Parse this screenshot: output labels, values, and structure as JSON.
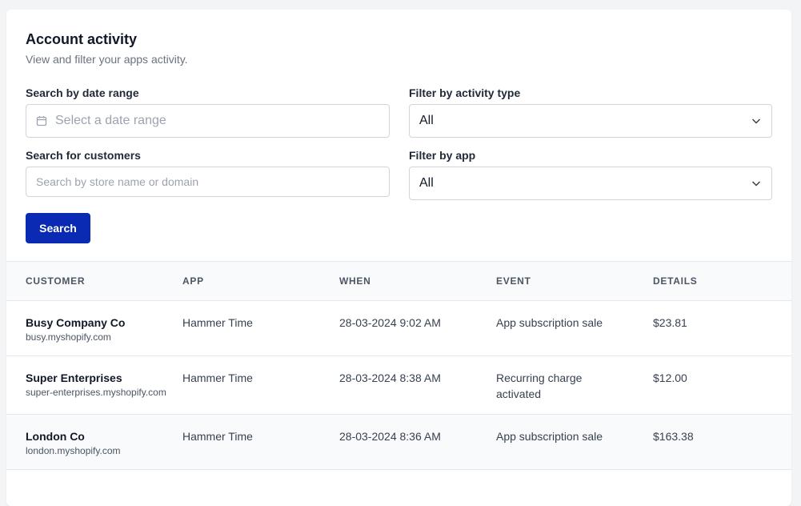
{
  "header": {
    "title": "Account activity",
    "subtitle": "View and filter your apps activity."
  },
  "filters": {
    "date_range": {
      "label": "Search by date range",
      "placeholder": "Select a date range"
    },
    "activity_type": {
      "label": "Filter by activity type",
      "value": "All"
    },
    "customers": {
      "label": "Search for customers",
      "placeholder": "Search by store name or domain"
    },
    "app": {
      "label": "Filter by app",
      "value": "All"
    },
    "search_button": "Search"
  },
  "table": {
    "columns": [
      "CUSTOMER",
      "APP",
      "WHEN",
      "EVENT",
      "DETAILS"
    ],
    "rows": [
      {
        "customer": "Busy Company Co",
        "domain": "busy.myshopify.com",
        "app": "Hammer Time",
        "when": "28-03-2024 9:02 AM",
        "event": "App subscription sale",
        "details": "$23.81"
      },
      {
        "customer": "Super Enterprises",
        "domain": "super-enterprises.myshopify.com",
        "app": "Hammer Time",
        "when": "28-03-2024 8:38 AM",
        "event": "Recurring charge activated",
        "details": "$12.00"
      },
      {
        "customer": "London Co",
        "domain": "london.myshopify.com",
        "app": "Hammer Time",
        "when": "28-03-2024 8:36 AM",
        "event": "App subscription sale",
        "details": "$163.38"
      }
    ]
  },
  "colors": {
    "primary": "#0b2ab4",
    "border": "#e5e7eb",
    "muted": "#6b7280"
  }
}
